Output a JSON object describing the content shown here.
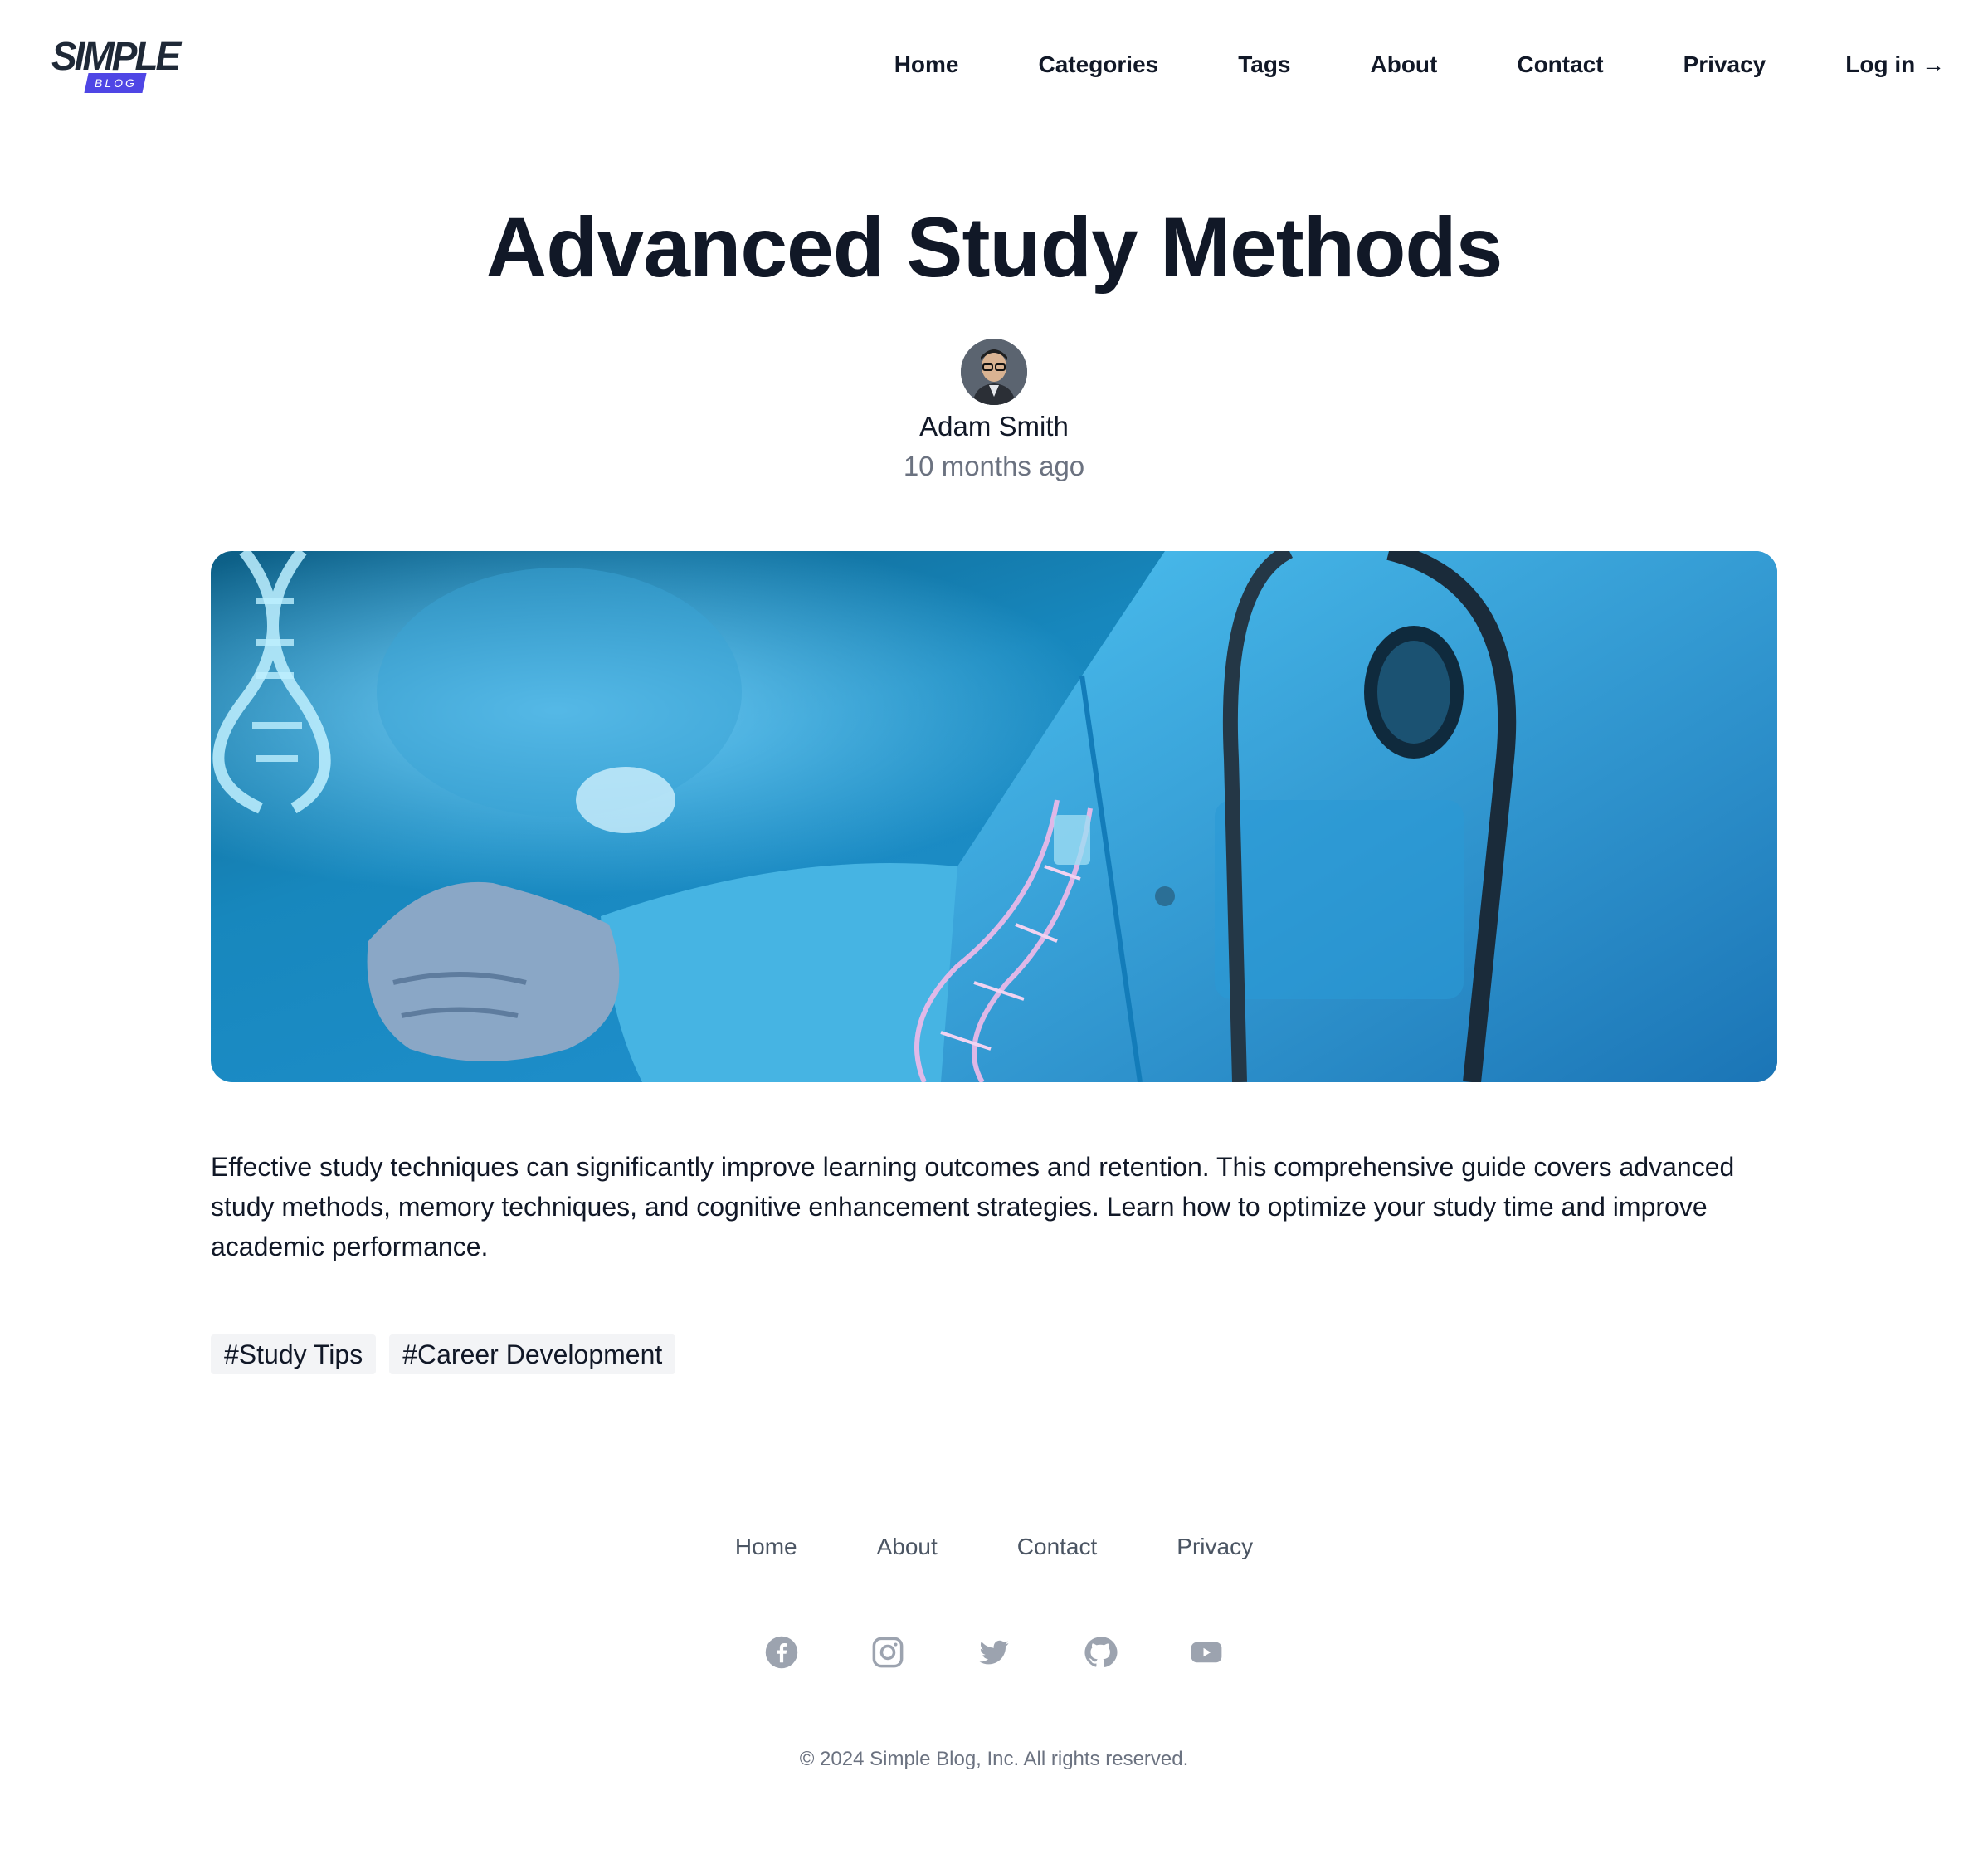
{
  "brand": {
    "logo_word": "SIMPLE",
    "logo_badge": "BLOG",
    "accent": "#4f46e5"
  },
  "nav": {
    "items": [
      {
        "label": "Home"
      },
      {
        "label": "Categories"
      },
      {
        "label": "Tags"
      },
      {
        "label": "About"
      },
      {
        "label": "Contact"
      },
      {
        "label": "Privacy"
      },
      {
        "label": "Log in →"
      }
    ]
  },
  "post": {
    "title": "Advanced Study Methods",
    "author": "Adam Smith",
    "published": "10 months ago",
    "body": "Effective study techniques can significantly improve learning outcomes and retention. This comprehensive guide covers advanced study methods, memory techniques, and cognitive enhancement strategies. Learn how to optimize your study time and improve academic performance.",
    "tags": [
      "#Study Tips",
      "#Career Development"
    ]
  },
  "footer": {
    "links": [
      {
        "label": "Home"
      },
      {
        "label": "About"
      },
      {
        "label": "Contact"
      },
      {
        "label": "Privacy"
      }
    ],
    "socials": [
      "facebook-icon",
      "instagram-icon",
      "twitter-icon",
      "github-icon",
      "youtube-icon"
    ],
    "copyright": "© 2024 Simple Blog, Inc. All rights reserved."
  }
}
